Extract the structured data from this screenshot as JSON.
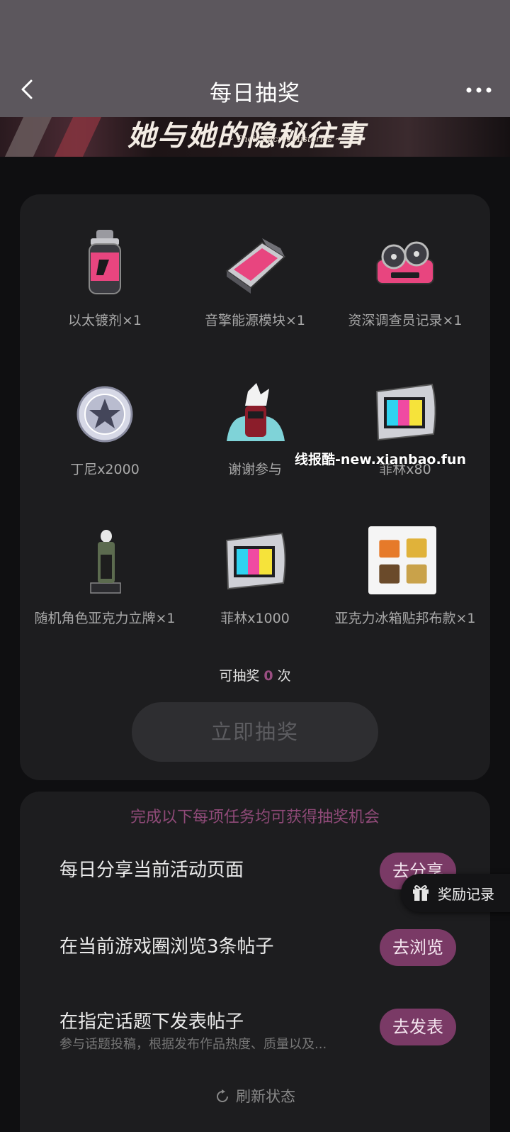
{
  "header": {
    "title": "每日抽奖"
  },
  "banner": {
    "title": "她与她的隐秘往事",
    "subtitle": "~ Their Secret Histories ~"
  },
  "prizes": [
    {
      "label": "以太镀剂×1",
      "icon": "ether-canister-icon"
    },
    {
      "label": "音擎能源模块×1",
      "icon": "energy-module-icon"
    },
    {
      "label": "资深调查员记录×1",
      "icon": "investigator-record-icon"
    },
    {
      "label": "丁尼x2000",
      "icon": "denny-coin-icon"
    },
    {
      "label": "谢谢参与",
      "icon": "thanks-mascot-icon"
    },
    {
      "label": "菲林x80",
      "icon": "film-icon"
    },
    {
      "label": "随机角色亚克力立牌×1",
      "icon": "acrylic-stand-icon"
    },
    {
      "label": "菲林x1000",
      "icon": "film-icon"
    },
    {
      "label": "亚克力冰箱贴邦布款×1",
      "icon": "fridge-magnet-icon"
    }
  ],
  "draw": {
    "prefix": "可抽奖",
    "count": "0",
    "suffix": "次",
    "button_label": "立即抽奖"
  },
  "watermark": "线报酷-new.xianbao.fun",
  "tasks": {
    "hint": "完成以下每项任务均可获得抽奖机会",
    "items": [
      {
        "text": "每日分享当前活动页面",
        "sub": "",
        "button": "去分享"
      },
      {
        "text": "在当前游戏圈浏览3条帖子",
        "sub": "",
        "button": "去浏览"
      },
      {
        "text": "在指定话题下发表帖子",
        "sub": "参与话题投稿，根据发布作品热度、质量以及...",
        "button": "去发表"
      }
    ],
    "refresh_label": "刷新状态"
  },
  "reward_fab": {
    "label": "奖励记录"
  },
  "colors": {
    "accent": "#7a3a66",
    "hint": "#8f4a78",
    "count": "#9a4e82"
  }
}
